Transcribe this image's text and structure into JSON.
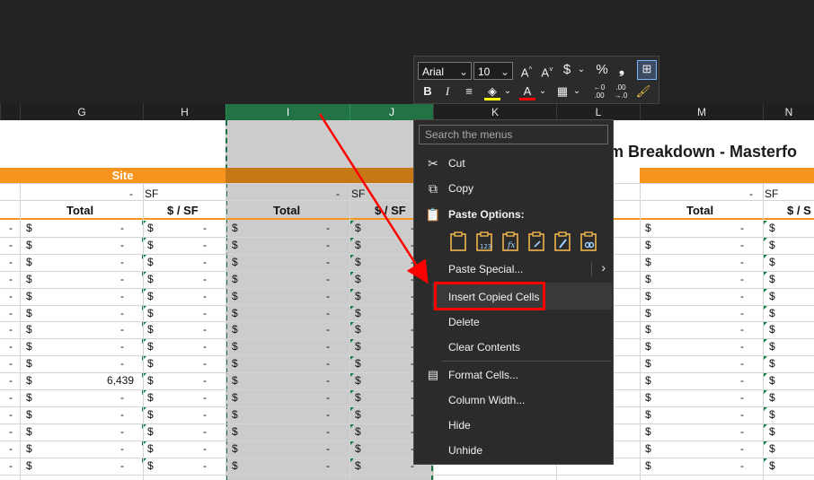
{
  "toolbar": {
    "font_name": "Arial",
    "font_size": "10",
    "grow_font": "A^",
    "shrink_font": "A˅",
    "currency": "$",
    "percent": "%",
    "comma": "❟",
    "bold": "B",
    "italic": "I",
    "align": "≡",
    "font_color_letter": "A",
    "inc_decimal": ".0→.00",
    "dec_decimal": ".00→.0"
  },
  "columns": [
    "G",
    "H",
    "I",
    "J",
    "K",
    "L",
    "M",
    "N"
  ],
  "sheet": {
    "title": "m Breakdown - Masterfo",
    "site_label": "Site",
    "dash": "-",
    "sf_label": "SF",
    "total_label": "Total",
    "per_sf_label": "$ / SF",
    "per_sf_partial": "$ / S",
    "dollar": "$",
    "value_6439": "6,439"
  },
  "menu": {
    "search_placeholder": "Search the menus",
    "cut": "Cut",
    "copy": "Copy",
    "paste_options": "Paste Options:",
    "paste_special": "Paste Special...",
    "insert_copied_cells": "Insert Copied Cells",
    "delete": "Delete",
    "clear_contents": "Clear Contents",
    "format_cells": "Format Cells...",
    "column_width": "Column Width...",
    "hide": "Hide",
    "unhide": "Unhide"
  },
  "colors": {
    "accent_green": "#217346",
    "orange": "#f7941d",
    "highlight_red": "#ff0000"
  }
}
